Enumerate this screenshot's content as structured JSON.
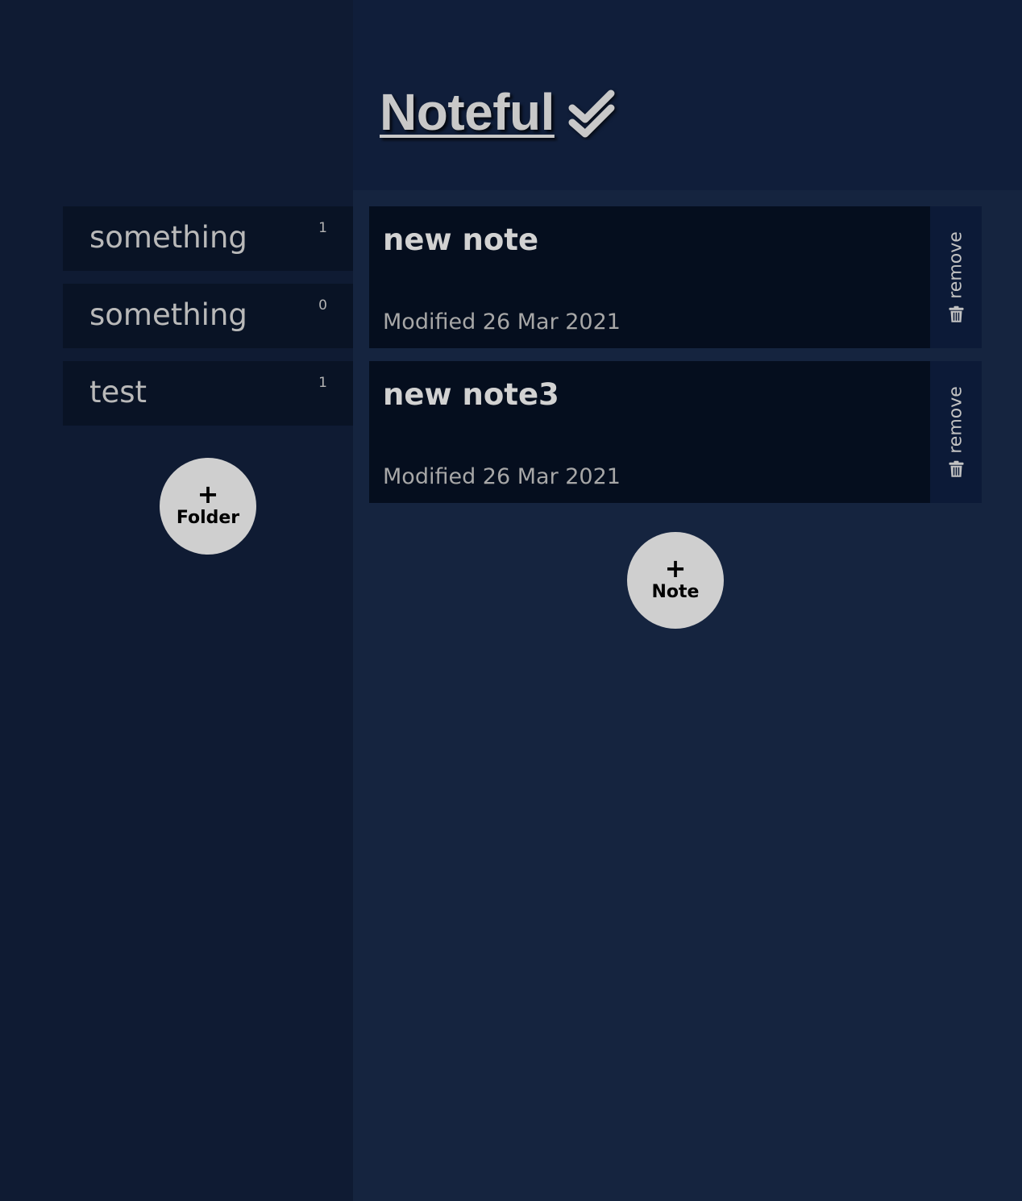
{
  "header": {
    "title": "Noteful",
    "title_icon": "double-check-icon"
  },
  "sidebar": {
    "folders": [
      {
        "name": "something",
        "count": "1"
      },
      {
        "name": "something",
        "count": "0"
      },
      {
        "name": "test",
        "count": "1"
      }
    ],
    "add_folder": {
      "icon": "plus-icon",
      "plus": "+",
      "label": "Folder"
    }
  },
  "main": {
    "notes": [
      {
        "title": "new note",
        "modified": "Modified 26 Mar 2021",
        "remove_label": "remove",
        "remove_icon": "trash-icon"
      },
      {
        "title": "new note3",
        "modified": "Modified 26 Mar 2021",
        "remove_label": "remove",
        "remove_icon": "trash-icon"
      }
    ],
    "add_note": {
      "icon": "plus-icon",
      "plus": "+",
      "label": "Note"
    }
  },
  "colors": {
    "sidebar_bg": "#0f1b33",
    "header_bg": "#101e3a",
    "main_bg": "#15243f",
    "item_bg": "#050e1e",
    "button_bg": "#cfcfcf",
    "text": "#c8c8c8"
  }
}
